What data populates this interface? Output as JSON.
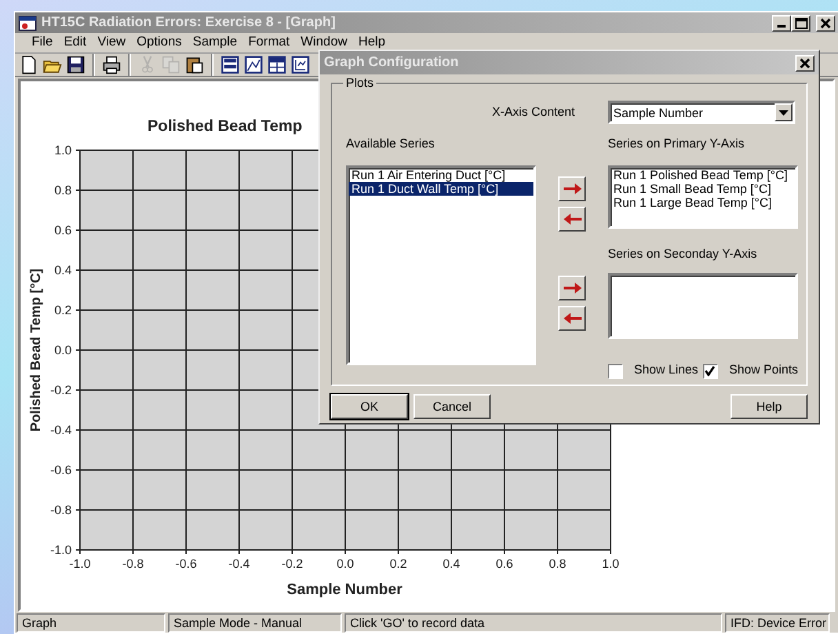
{
  "window": {
    "title": "HT15C Radiation Errors: Exercise 8 - [Graph]"
  },
  "menu": [
    {
      "label": "File"
    },
    {
      "label": "Edit"
    },
    {
      "label": "View"
    },
    {
      "label": "Options"
    },
    {
      "label": "Sample"
    },
    {
      "label": "Format"
    },
    {
      "label": "Window"
    },
    {
      "label": "Help"
    }
  ],
  "toolbar": [
    {
      "kind": "new",
      "disabled": false
    },
    {
      "kind": "open",
      "disabled": false
    },
    {
      "kind": "save",
      "disabled": false
    },
    {
      "kind": "sep"
    },
    {
      "kind": "print",
      "disabled": false
    },
    {
      "kind": "sep"
    },
    {
      "kind": "cut",
      "disabled": true
    },
    {
      "kind": "copy",
      "disabled": true
    },
    {
      "kind": "paste",
      "disabled": false
    },
    {
      "kind": "sep"
    },
    {
      "kind": "panel",
      "disabled": false
    },
    {
      "kind": "imagepanel",
      "disabled": false
    },
    {
      "kind": "tablepanel",
      "disabled": false
    },
    {
      "kind": "chartpanel",
      "disabled": false
    }
  ],
  "graph": {
    "chart_data": {
      "type": "scatter",
      "title": "Polished Bead Temp",
      "xlabel": "Sample Number",
      "ylabel": "Polished Bead Temp [°C]",
      "xlim": [
        -1,
        1
      ],
      "ylim": [
        -1,
        1
      ],
      "grid": true,
      "xticks": [
        {
          "value": -1,
          "label": "-1.0"
        },
        {
          "value": -0.8,
          "label": "-0.8"
        },
        {
          "value": -0.6,
          "label": "-0.6"
        },
        {
          "value": -0.4,
          "label": "-0.4"
        },
        {
          "value": -0.2,
          "label": "-0.2"
        },
        {
          "value": 0,
          "label": "0.0"
        },
        {
          "value": 0.2,
          "label": "0.2"
        },
        {
          "value": 0.4,
          "label": "0.4"
        },
        {
          "value": 0.6,
          "label": "0.6"
        },
        {
          "value": 0.8,
          "label": "0.8"
        },
        {
          "value": 1,
          "label": "1.0"
        }
      ],
      "yticks": [
        {
          "value": 1,
          "label": "1.0"
        },
        {
          "value": 0.8,
          "label": "0.8"
        },
        {
          "value": 0.6,
          "label": "0.6"
        },
        {
          "value": 0.4,
          "label": "0.4"
        },
        {
          "value": 0.2,
          "label": "0.2"
        },
        {
          "value": 0,
          "label": "0.0"
        },
        {
          "value": -0.2,
          "label": "-0.2"
        },
        {
          "value": -0.4,
          "label": "-0.4"
        },
        {
          "value": -0.6,
          "label": "-0.6"
        },
        {
          "value": -0.8,
          "label": "-0.8"
        },
        {
          "value": -1,
          "label": "-1.0"
        }
      ]
    }
  },
  "dialog": {
    "title": "Graph Configuration",
    "group": "Plots",
    "x_axis_label": "X-Axis Content",
    "x_axis_value": "Sample Number",
    "available_label": "Available Series",
    "available": [
      {
        "label": "Run 1 Air Entering Duct [°C]",
        "selected": false
      },
      {
        "label": "Run 1 Duct Wall Temp [°C]",
        "selected": true
      }
    ],
    "primary_label": "Series on Primary Y-Axis",
    "primary": [
      {
        "label": "Run 1 Polished Bead Temp [°C]",
        "selected": false
      },
      {
        "label": "Run 1 Small Bead Temp [°C]",
        "selected": false
      },
      {
        "label": "Run 1 Large Bead Temp [°C]",
        "selected": false
      }
    ],
    "secondary_label": "Series on Seconday Y-Axis",
    "options": [
      {
        "label": "Show Lines",
        "checked": false
      },
      {
        "label": "Show Points",
        "checked": true
      }
    ],
    "buttons": [
      {
        "label": "OK",
        "kind": "default"
      },
      {
        "label": "Cancel",
        "kind": "normal"
      },
      {
        "label": "Help",
        "kind": "right"
      }
    ]
  },
  "status_bar": [
    "Graph",
    "Sample Mode - Manual",
    "Click 'GO' to record data",
    "IFD: Device Error"
  ]
}
